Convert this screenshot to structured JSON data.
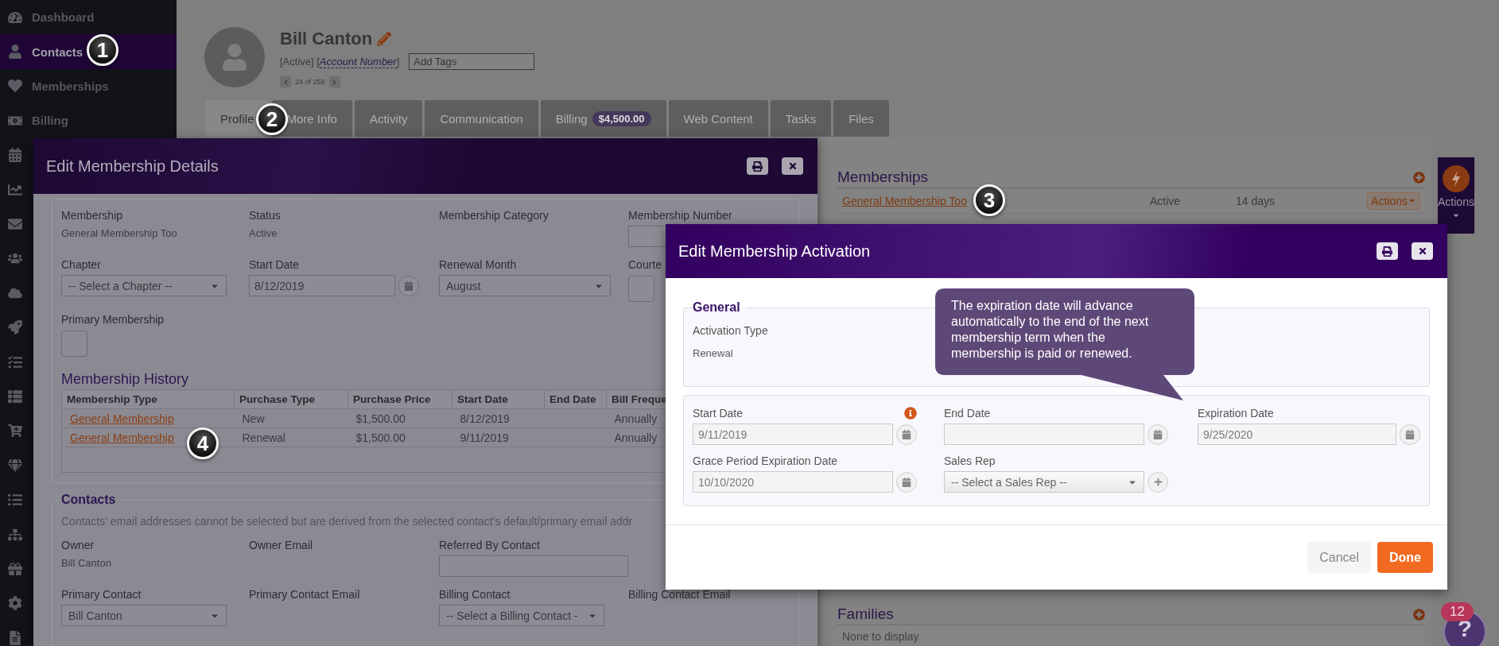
{
  "sidebar": {
    "items": [
      {
        "label": "Dashboard",
        "selected": false
      },
      {
        "label": "Contacts",
        "selected": true
      },
      {
        "label": "Memberships",
        "selected": false
      },
      {
        "label": "Billing",
        "selected": false
      },
      {
        "selected": false
      },
      {
        "selected": false
      },
      {
        "selected": false
      },
      {
        "selected": false
      },
      {
        "selected": false
      },
      {
        "selected": false
      },
      {
        "selected": false
      },
      {
        "selected": false
      },
      {
        "selected": false
      },
      {
        "selected": false
      },
      {
        "selected": false
      },
      {
        "selected": false
      },
      {
        "selected": false
      },
      {
        "selected": false
      },
      {
        "selected": false
      }
    ]
  },
  "contact": {
    "name": "Bill Canton",
    "status_prefix": "[Active] [",
    "account_link": "Account Number",
    "status_suffix": "]",
    "tags": {
      "placeholder": "Add Tags"
    },
    "pager": "24 of 259"
  },
  "tabs": [
    {
      "label": "Profile",
      "selected": true
    },
    {
      "label": "More Info",
      "selected": false
    },
    {
      "label": "Activity",
      "selected": false
    },
    {
      "label": "Communication",
      "selected": false
    },
    {
      "label": "Billing",
      "badge": "$4,500.00",
      "selected": false
    },
    {
      "label": "Web Content",
      "selected": false
    },
    {
      "label": "Tasks",
      "selected": false
    },
    {
      "label": "Files",
      "selected": false
    }
  ],
  "memberships": {
    "title": "Memberships",
    "rows": [
      {
        "name": "General Membership Too",
        "status": "Active",
        "term": "14 days",
        "action": "Actions"
      }
    ]
  },
  "families": {
    "title": "Families",
    "empty": "None to display"
  },
  "actions_tab": {
    "label": "Actions"
  },
  "help": {
    "glyph": "?",
    "badge": "12"
  },
  "markers": [
    "1",
    "2",
    "3",
    "4"
  ],
  "details_modal": {
    "title": "Edit Membership Details",
    "rows": [
      [
        {
          "kind": "text",
          "label": "Membership",
          "value": "General Membership Too"
        },
        {
          "kind": "text",
          "label": "Status",
          "value": "Active"
        },
        {
          "kind": "label",
          "label": "Membership Category"
        },
        {
          "kind": "input",
          "label": "Membership Number"
        }
      ],
      [
        {
          "kind": "select",
          "label": "Chapter",
          "value": "-- Select a Chapter --"
        },
        {
          "kind": "date",
          "label": "Start Date",
          "value": "8/12/2019"
        },
        {
          "kind": "select",
          "label": "Renewal Month",
          "value": "August"
        },
        {
          "kind": "checkbox",
          "label": "Courte",
          "checked": false
        }
      ],
      [
        {
          "kind": "checkbox",
          "label": "Primary Membership",
          "checked": false
        }
      ]
    ],
    "history": {
      "title": "Membership History",
      "columns": [
        "Membership Type",
        "Purchase Type",
        "Purchase Price",
        "Start Date",
        "End Date",
        "Bill Freque"
      ],
      "rows": [
        [
          "General Membership",
          "New",
          "$1,500.00",
          "8/12/2019",
          "",
          "Annually"
        ],
        [
          "General Membership",
          "Renewal",
          "$1,500.00",
          "9/11/2019",
          "",
          "Annually"
        ]
      ]
    },
    "contacts": {
      "legend": "Contacts",
      "note": "Contacts' email addresses cannot be selected but are derived from the selected contact's default/primary email addr",
      "rows": [
        [
          {
            "kind": "text",
            "label": "Owner",
            "value": "Bill Canton"
          },
          {
            "kind": "label",
            "label": "Owner Email"
          },
          {
            "kind": "input",
            "label": "Referred By Contact"
          }
        ],
        [
          {
            "kind": "select",
            "label": "Primary Contact",
            "value": "Bill Canton"
          },
          {
            "kind": "label",
            "label": "Primary Contact Email"
          },
          {
            "kind": "select",
            "label": "Billing Contact",
            "value": "-- Select a Billing Contact -"
          },
          {
            "kind": "label",
            "label": "Billing Contact Email"
          }
        ]
      ]
    }
  },
  "activation_modal": {
    "title": "Edit Membership Activation",
    "general": {
      "legend": "General",
      "label": "Activation Type",
      "value": "Renewal"
    },
    "fields": [
      {
        "kind": "date",
        "label": "Start Date",
        "value": "9/11/2019",
        "info": true
      },
      {
        "kind": "date",
        "label": "End Date"
      },
      {
        "kind": "date",
        "label": "Expiration Date",
        "value": "9/25/2020"
      },
      {
        "kind": "date",
        "label": "Grace Period Expiration Date",
        "value": "10/10/2020"
      },
      {
        "kind": "select",
        "label": "Sales Rep",
        "value": "-- Select a Sales Rep --"
      }
    ],
    "tooltip": "The expiration date will advance automatically to the end of the next membership term when the membership is paid or renewed.",
    "buttons": [
      {
        "label": "Cancel",
        "kind": "secondary"
      },
      {
        "label": "Done",
        "kind": "primary"
      }
    ]
  }
}
